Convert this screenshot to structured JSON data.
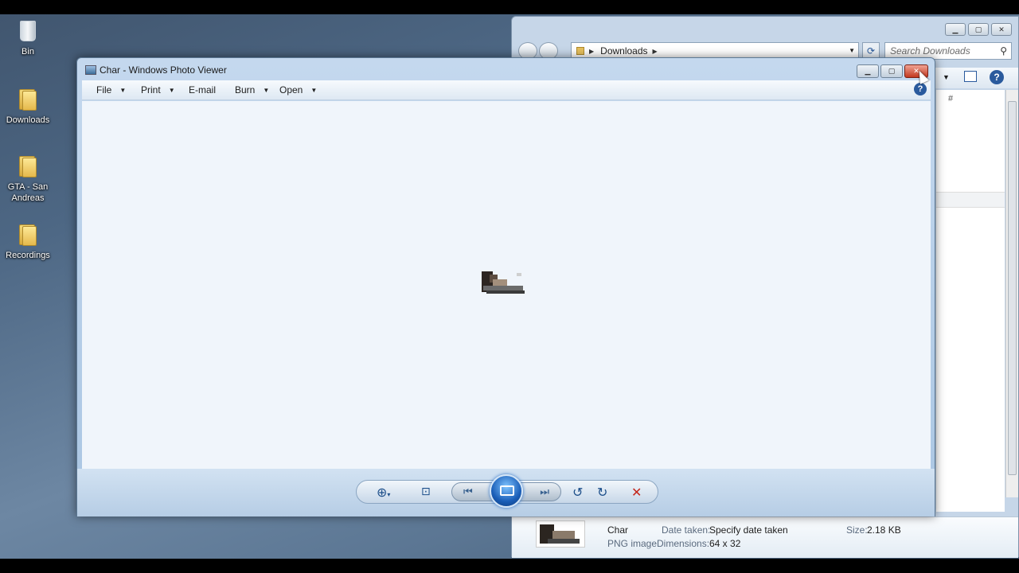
{
  "desktop": {
    "icons": [
      {
        "label": "Bin",
        "icon": "recycle-bin-icon"
      },
      {
        "label": "Downloads",
        "icon": "folder-icon"
      },
      {
        "label": "GTA - San Andreas",
        "icon": "folder-icon"
      },
      {
        "label": "Recordings",
        "icon": "folder-icon"
      }
    ]
  },
  "explorer": {
    "address_path": "Downloads",
    "search_placeholder": "Search Downloads",
    "column_header": "#",
    "details": {
      "name": "Char",
      "type": "PNG image",
      "date_taken_label": "Date taken:",
      "date_taken_value": "Specify date taken",
      "dimensions_label": "Dimensions:",
      "dimensions_value": "64 x 32",
      "size_label": "Size:",
      "size_value": "2.18 KB"
    }
  },
  "viewer": {
    "title": "Char - Windows Photo Viewer",
    "menu": {
      "file": "File",
      "print": "Print",
      "email": "E-mail",
      "burn": "Burn",
      "open": "Open"
    },
    "help_glyph": "?",
    "controls": {
      "zoom": "zoom-icon",
      "actual_size": "fit-window-icon",
      "previous": "previous-icon",
      "slideshow": "slideshow-icon",
      "next": "next-icon",
      "rotate_ccw": "rotate-counterclockwise-icon",
      "rotate_cw": "rotate-clockwise-icon",
      "delete": "delete-icon"
    }
  },
  "colors": {
    "desktop_bg": "#4d6784",
    "close_button": "#c2381f",
    "accent_blue": "#1a5eb8"
  }
}
